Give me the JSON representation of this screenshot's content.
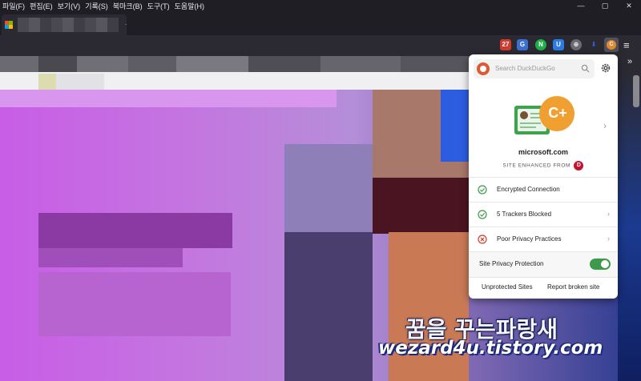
{
  "menu": {
    "items": [
      "파일(F)",
      "편집(E)",
      "보기(V)",
      "기록(S)",
      "북마크(B)",
      "도구(T)",
      "도움말(H)"
    ]
  },
  "window_controls": {
    "minimize": "—",
    "restore": "▢",
    "close": "✕"
  },
  "tab": {
    "close_glyph": "."
  },
  "toolbar": {
    "extensions": [
      {
        "name": "calendar-ext-icon",
        "text": "27",
        "color": "#d13b2e"
      },
      {
        "name": "translate-ext-icon",
        "text": "G",
        "color": "#3b6fd1"
      },
      {
        "name": "n-ext-icon",
        "text": "N",
        "color": "#1fae4b"
      },
      {
        "name": "shield-ext-icon",
        "text": "U",
        "color": "#2a7be4"
      },
      {
        "name": "globe-ext-icon",
        "text": "⊕",
        "color": "#6a6a70"
      },
      {
        "name": "arrow-ext-icon",
        "text": "⬇",
        "color": "#2b2a33"
      },
      {
        "name": "ddg-ext-icon",
        "text": "C",
        "color": "#de8a33"
      }
    ],
    "menu_glyph": "≡",
    "overflow_glyph": "»"
  },
  "popup": {
    "search_placeholder": "Search DuckDuckGo",
    "grade": "C+",
    "site": "microsoft.com",
    "enhanced_label": "SITE ENHANCED FROM",
    "enhanced_grade": "D",
    "rows": [
      {
        "label": "Encrypted Connection",
        "status": "good"
      },
      {
        "label": "5 Trackers Blocked",
        "status": "good"
      },
      {
        "label": "Poor Privacy Practices",
        "status": "bad"
      }
    ],
    "protection_label": "Site Privacy Protection",
    "protection_on": true,
    "unprotected_link": "Unprotected Sites",
    "report_link": "Report broken site"
  },
  "watermark": {
    "line1": "꿈을 꾸는파랑새",
    "line2": "wezard4u.tistory.com"
  },
  "colors": {
    "good": "#3c9a4a",
    "bad": "#d13b2e",
    "ddg_orange": "#de5833",
    "grade_orange": "#f0a030"
  }
}
